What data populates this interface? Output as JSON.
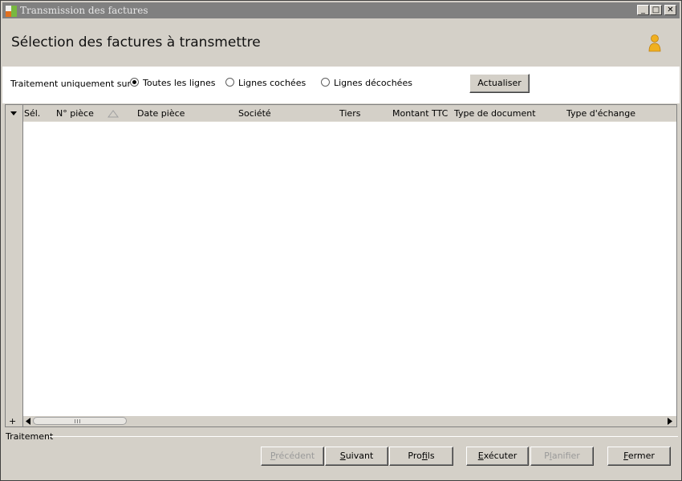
{
  "window": {
    "title": "Transmission des factures",
    "controls": {
      "minimize": "_",
      "maximize": "□",
      "close": "✕"
    }
  },
  "header": {
    "title": "Sélection des factures à transmettre",
    "icon": "user-icon"
  },
  "filter": {
    "label": "Traitement uniquement sur :",
    "options": [
      {
        "label": "Toutes les lignes",
        "selected": true
      },
      {
        "label": "Lignes cochées",
        "selected": false
      },
      {
        "label": "Lignes décochées",
        "selected": false
      }
    ],
    "refresh_button": "Actualiser"
  },
  "grid": {
    "columns": [
      "Sél.",
      "N° pièce",
      "Date pièce",
      "Société",
      "Tiers",
      "Montant TTC",
      "Type de document",
      "Type d'échange"
    ],
    "rows": [],
    "add_row_label": "+"
  },
  "status": {
    "label": "Traitement"
  },
  "actions": {
    "previous": {
      "pre": "",
      "key": "P",
      "post": "récédent",
      "enabled": false
    },
    "next": {
      "pre": "",
      "key": "S",
      "post": "uivant",
      "enabled": true
    },
    "profiles": {
      "pre": "Pro",
      "key": "f",
      "post": "ils",
      "enabled": true
    },
    "execute": {
      "pre": "",
      "key": "E",
      "post": "xécuter",
      "enabled": true
    },
    "schedule": {
      "pre": "P",
      "key": "l",
      "post": "anifier",
      "enabled": false
    },
    "close": {
      "pre": "",
      "key": "F",
      "post": "ermer",
      "enabled": true
    }
  }
}
